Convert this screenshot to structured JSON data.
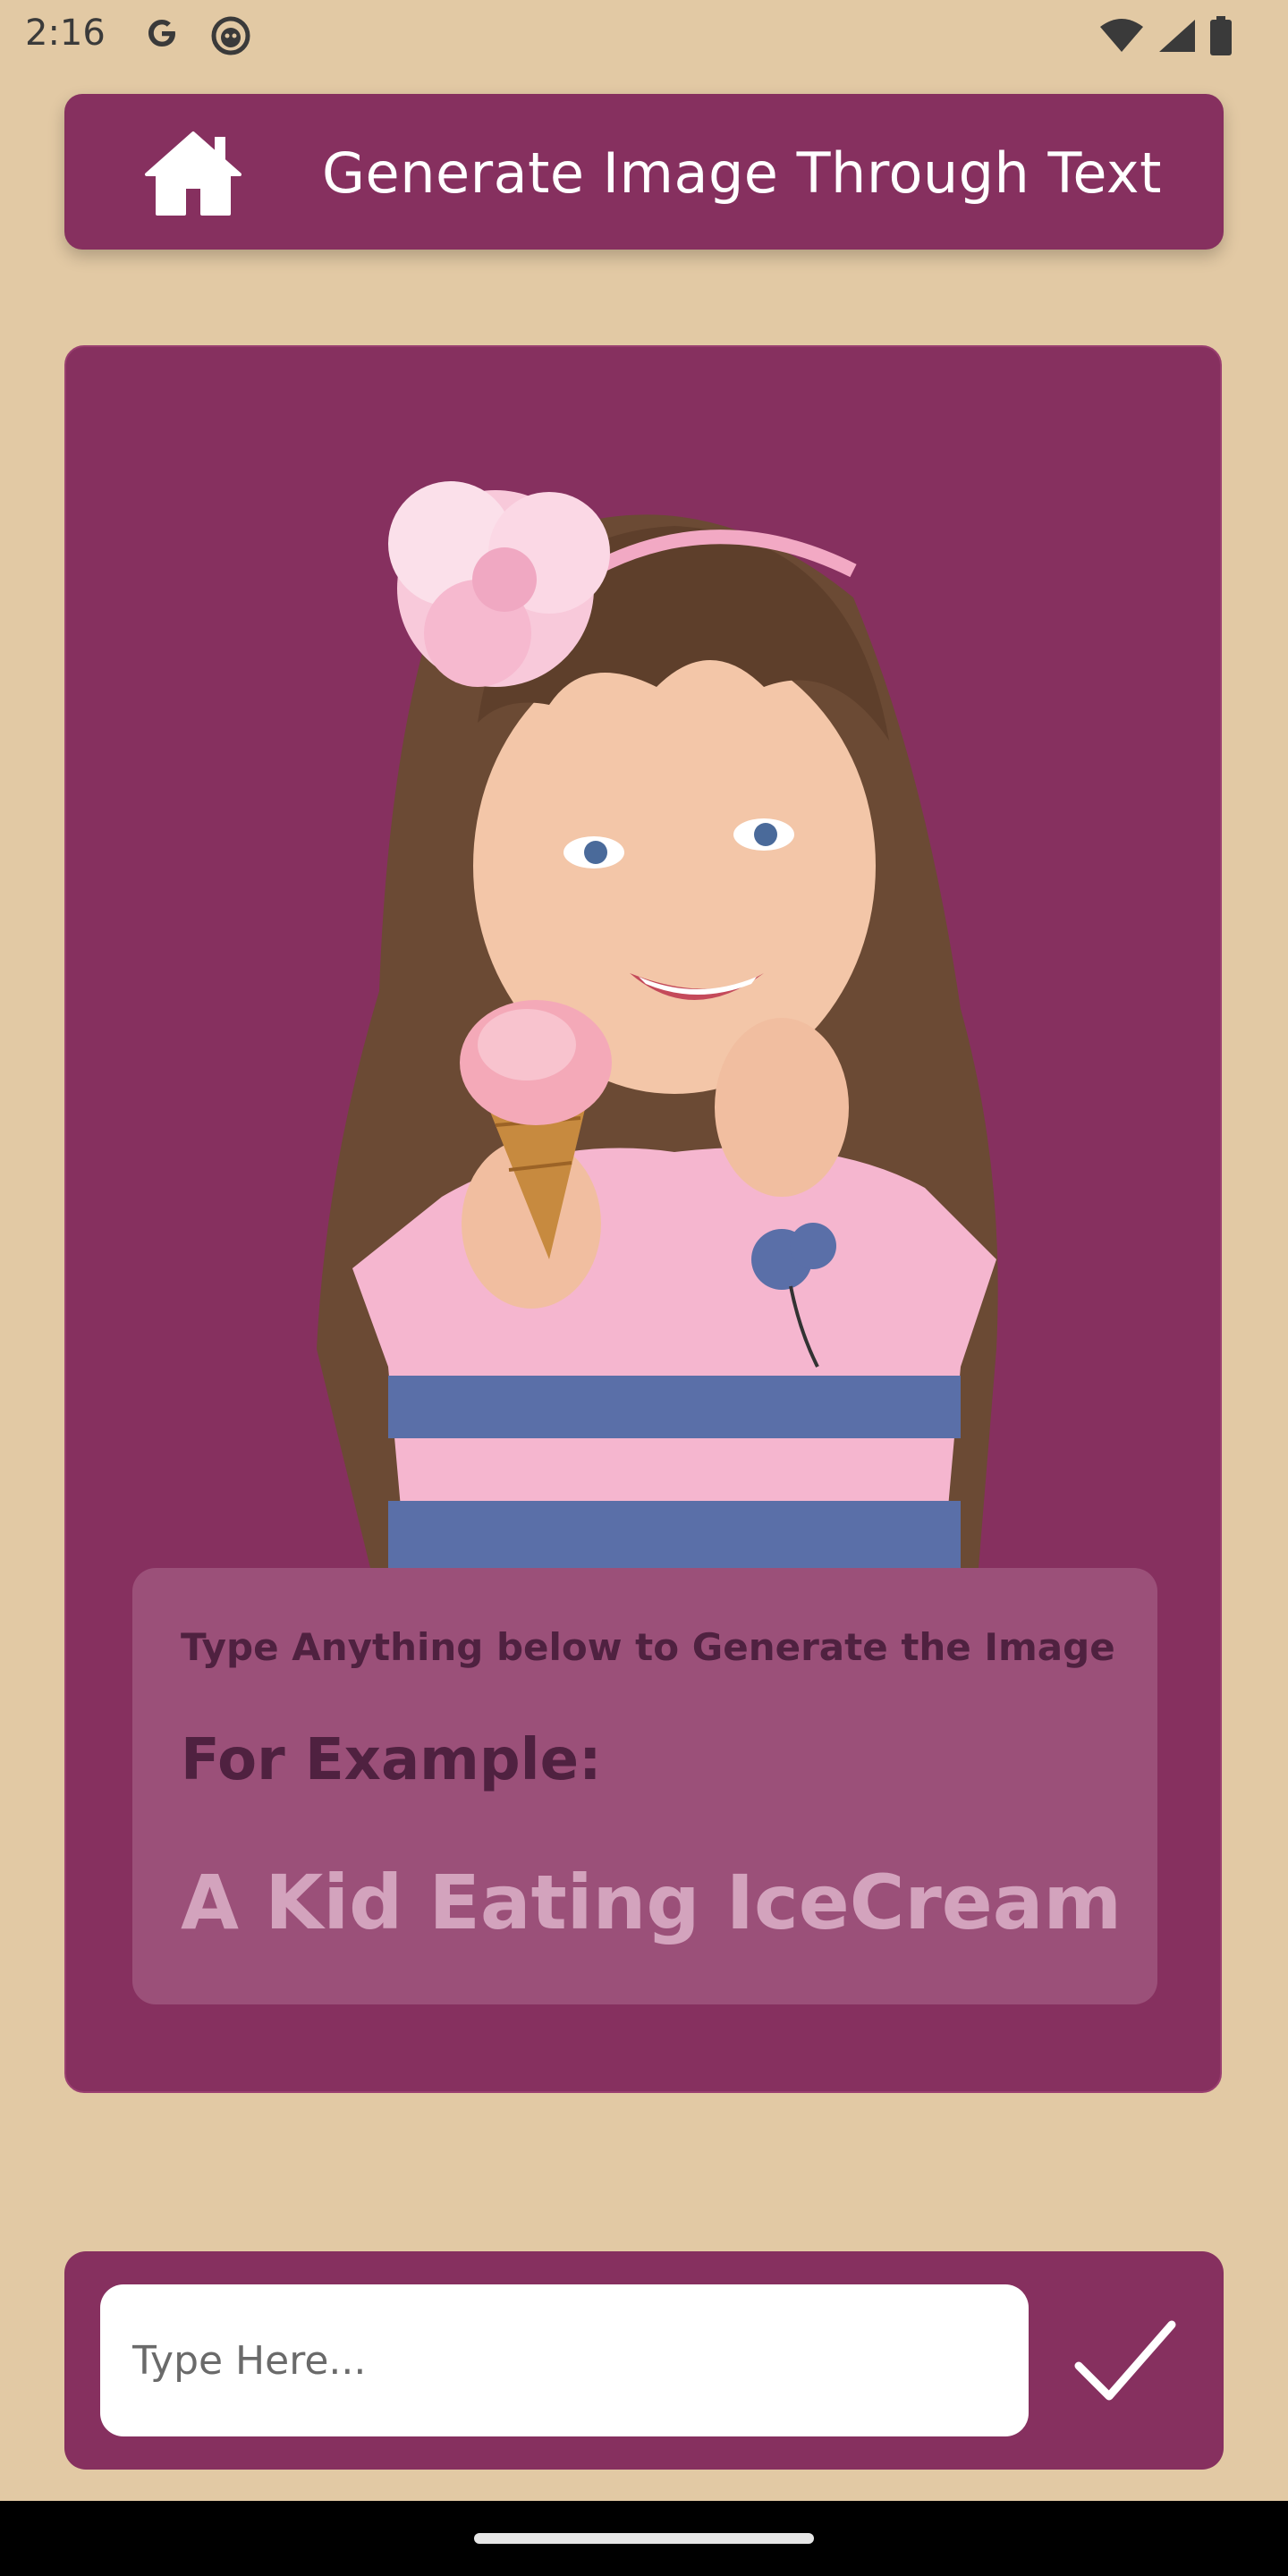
{
  "status_bar": {
    "time": "2:16"
  },
  "header": {
    "title": "Generate Image Through Text",
    "home_icon": "home-icon"
  },
  "card": {
    "info": {
      "instruction": "Type Anything below to Generate the Image",
      "example_label": "For Example:",
      "example_text": "A Kid Eating IceCream"
    }
  },
  "input": {
    "placeholder": "Type Here...",
    "value": "",
    "submit_icon": "checkmark-icon"
  },
  "colors": {
    "background": "#e2c9a4",
    "primary": "#86305f",
    "panel": "#9b5079",
    "accent_text": "#d3a3bd"
  }
}
